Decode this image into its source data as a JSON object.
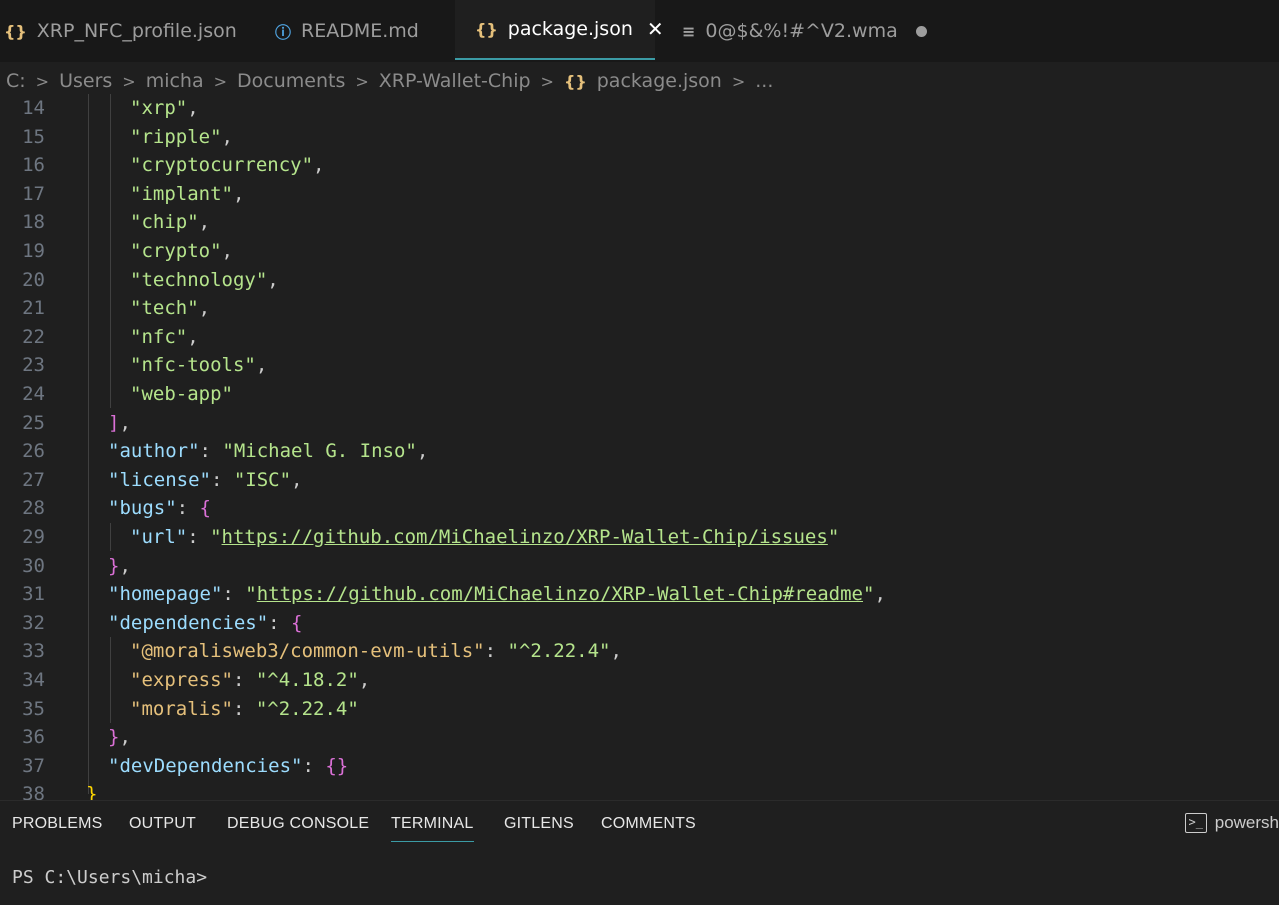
{
  "tabs": [
    {
      "icon": "{}",
      "label": "XRP_NFC_profile.json"
    },
    {
      "icon": "ⓘ",
      "label": "README.md"
    },
    {
      "icon": "{}",
      "label": "package.json",
      "close": "✕"
    },
    {
      "icon": "≡",
      "label": "0@$&%!#^V2.wma"
    }
  ],
  "breadcrumb": [
    "C:",
    "Users",
    "micha",
    "Documents",
    "XRP-Wallet-Chip",
    "package.json",
    "..."
  ],
  "editor": {
    "line_numbers": [
      "14",
      "15",
      "16",
      "17",
      "18",
      "19",
      "20",
      "21",
      "22",
      "23",
      "24",
      "25",
      "26",
      "27",
      "28",
      "29",
      "30",
      "31",
      "32",
      "33",
      "34",
      "35",
      "36",
      "37",
      "38"
    ],
    "keywords": [
      "\"xrp\"",
      "\"ripple\"",
      "\"cryptocurrency\"",
      "\"implant\"",
      "\"chip\"",
      "\"crypto\"",
      "\"technology\"",
      "\"tech\"",
      "\"nfc\"",
      "\"nfc-tools\"",
      "\"web-app\""
    ],
    "author_key": "\"author\"",
    "author_val": "\"Michael G. Inso\"",
    "license_key": "\"license\"",
    "license_val": "\"ISC\"",
    "bugs_key": "\"bugs\"",
    "url_key": "\"url\"",
    "url_val": "https://github.com/MiChaelinzo/XRP-Wallet-Chip/issues",
    "homepage_key": "\"homepage\"",
    "homepage_val": "https://github.com/MiChaelinzo/XRP-Wallet-Chip#readme",
    "deps_key": "\"dependencies\"",
    "dep1_key": "\"@moralisweb3/common-evm-utils\"",
    "dep1_val": "\"^2.22.4\"",
    "dep2_key": "\"express\"",
    "dep2_val": "\"^4.18.2\"",
    "dep3_key": "\"moralis\"",
    "dep3_val": "\"^2.22.4\"",
    "devdeps_key": "\"devDependencies\""
  },
  "panel": {
    "tabs": [
      "PROBLEMS",
      "OUTPUT",
      "DEBUG CONSOLE",
      "TERMINAL",
      "GITLENS",
      "COMMENTS"
    ],
    "shell": "powersh",
    "prompt": "PS C:\\Users\\micha>"
  }
}
